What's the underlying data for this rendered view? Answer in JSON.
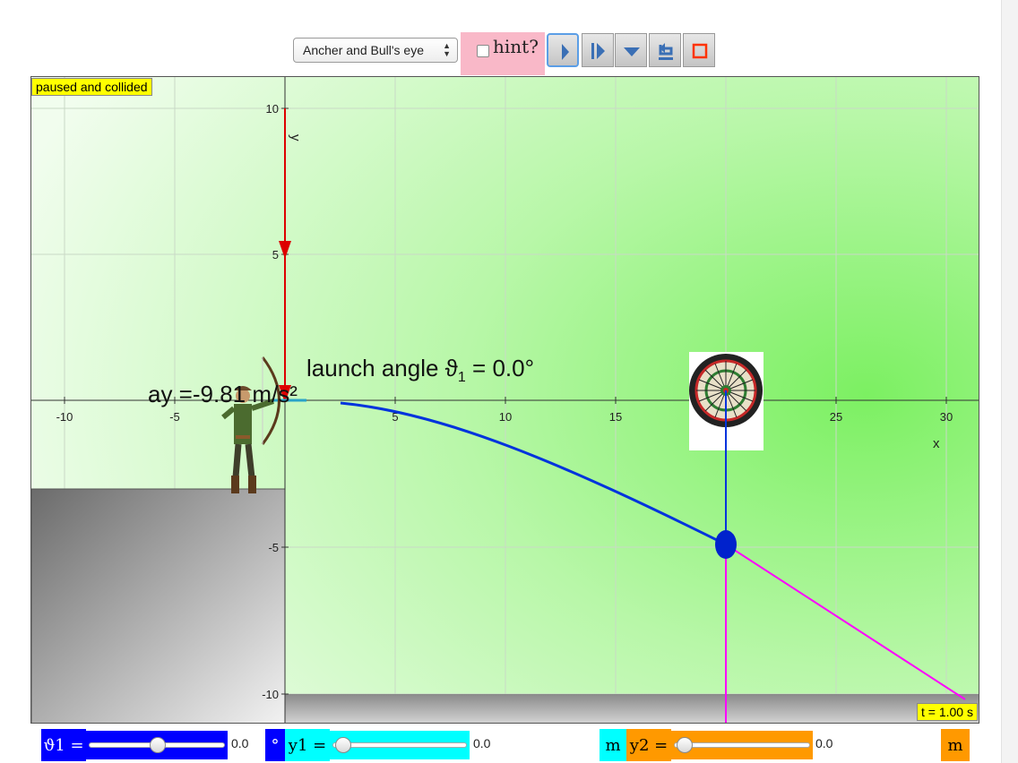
{
  "toolbar": {
    "scenario": "Ancher and Bull's eye",
    "hint_label": "hint?",
    "hint_checked": false,
    "buttons": [
      "play-icon",
      "step-icon",
      "menu-down-icon",
      "reset-icon",
      "stop-icon"
    ]
  },
  "sim": {
    "status": "paused and collided",
    "time": "t = 1.00 s",
    "launch_label_prefix": "launch angle ϑ",
    "launch_label_sub": "1",
    "launch_label_suffix": " = 0.0°",
    "accel_label": "ay =-9.81 m/s²",
    "axis_x_label": "x",
    "axis_y_label": "y",
    "x_ticks": [
      "-10",
      "-5",
      "5",
      "10",
      "15",
      "20",
      "25",
      "30"
    ],
    "y_ticks": [
      "10",
      "5",
      "-5",
      "-10"
    ]
  },
  "sliders": {
    "theta_label": "ϑ1 =",
    "theta_value": "0.0",
    "theta_unit": "°",
    "theta_fraction": 0.5,
    "y1_label": "y1 =",
    "y1_value": "0.0",
    "y1_unit": "m",
    "y1_fraction": 0.0,
    "y2_label": "y2 =",
    "y2_value": "0.0",
    "y2_unit": "m",
    "y2_fraction": 0.0
  },
  "colors": {
    "theta": "#0000ff",
    "y1": "#00ffff",
    "y2": "#ff9900",
    "trajectory": "#0033dd",
    "accel_arrow": "#dd0000",
    "guide_line": "#ff00ff",
    "hint_bg": "#f9b8c8",
    "badge": "#ffff00"
  }
}
